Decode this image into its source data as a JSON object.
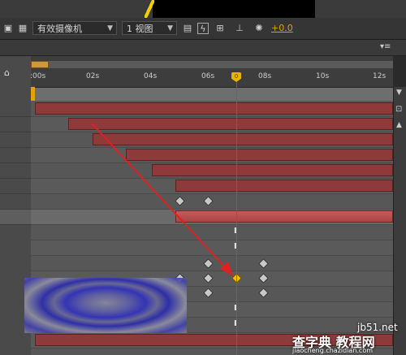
{
  "toolbar": {
    "camera_label": "有效摄像机",
    "view_label": "1 视图",
    "offset_value": "+0.0"
  },
  "ruler": {
    "ticks": [
      ":00s",
      "02s",
      "04s",
      "06s",
      "08s",
      "10s",
      "12s"
    ],
    "cti_label": "0"
  },
  "watermark": {
    "line1": "jb51.net",
    "line2": "查字典 教程网",
    "line3": "jiaocheng.chazidian.com"
  },
  "colors": {
    "layer_bar": "#8e3a3a",
    "selected_layer_bar": "#c85959",
    "keyframe_selected": "#f2c000",
    "cti": "#e03030",
    "arrow": "#e02020"
  }
}
